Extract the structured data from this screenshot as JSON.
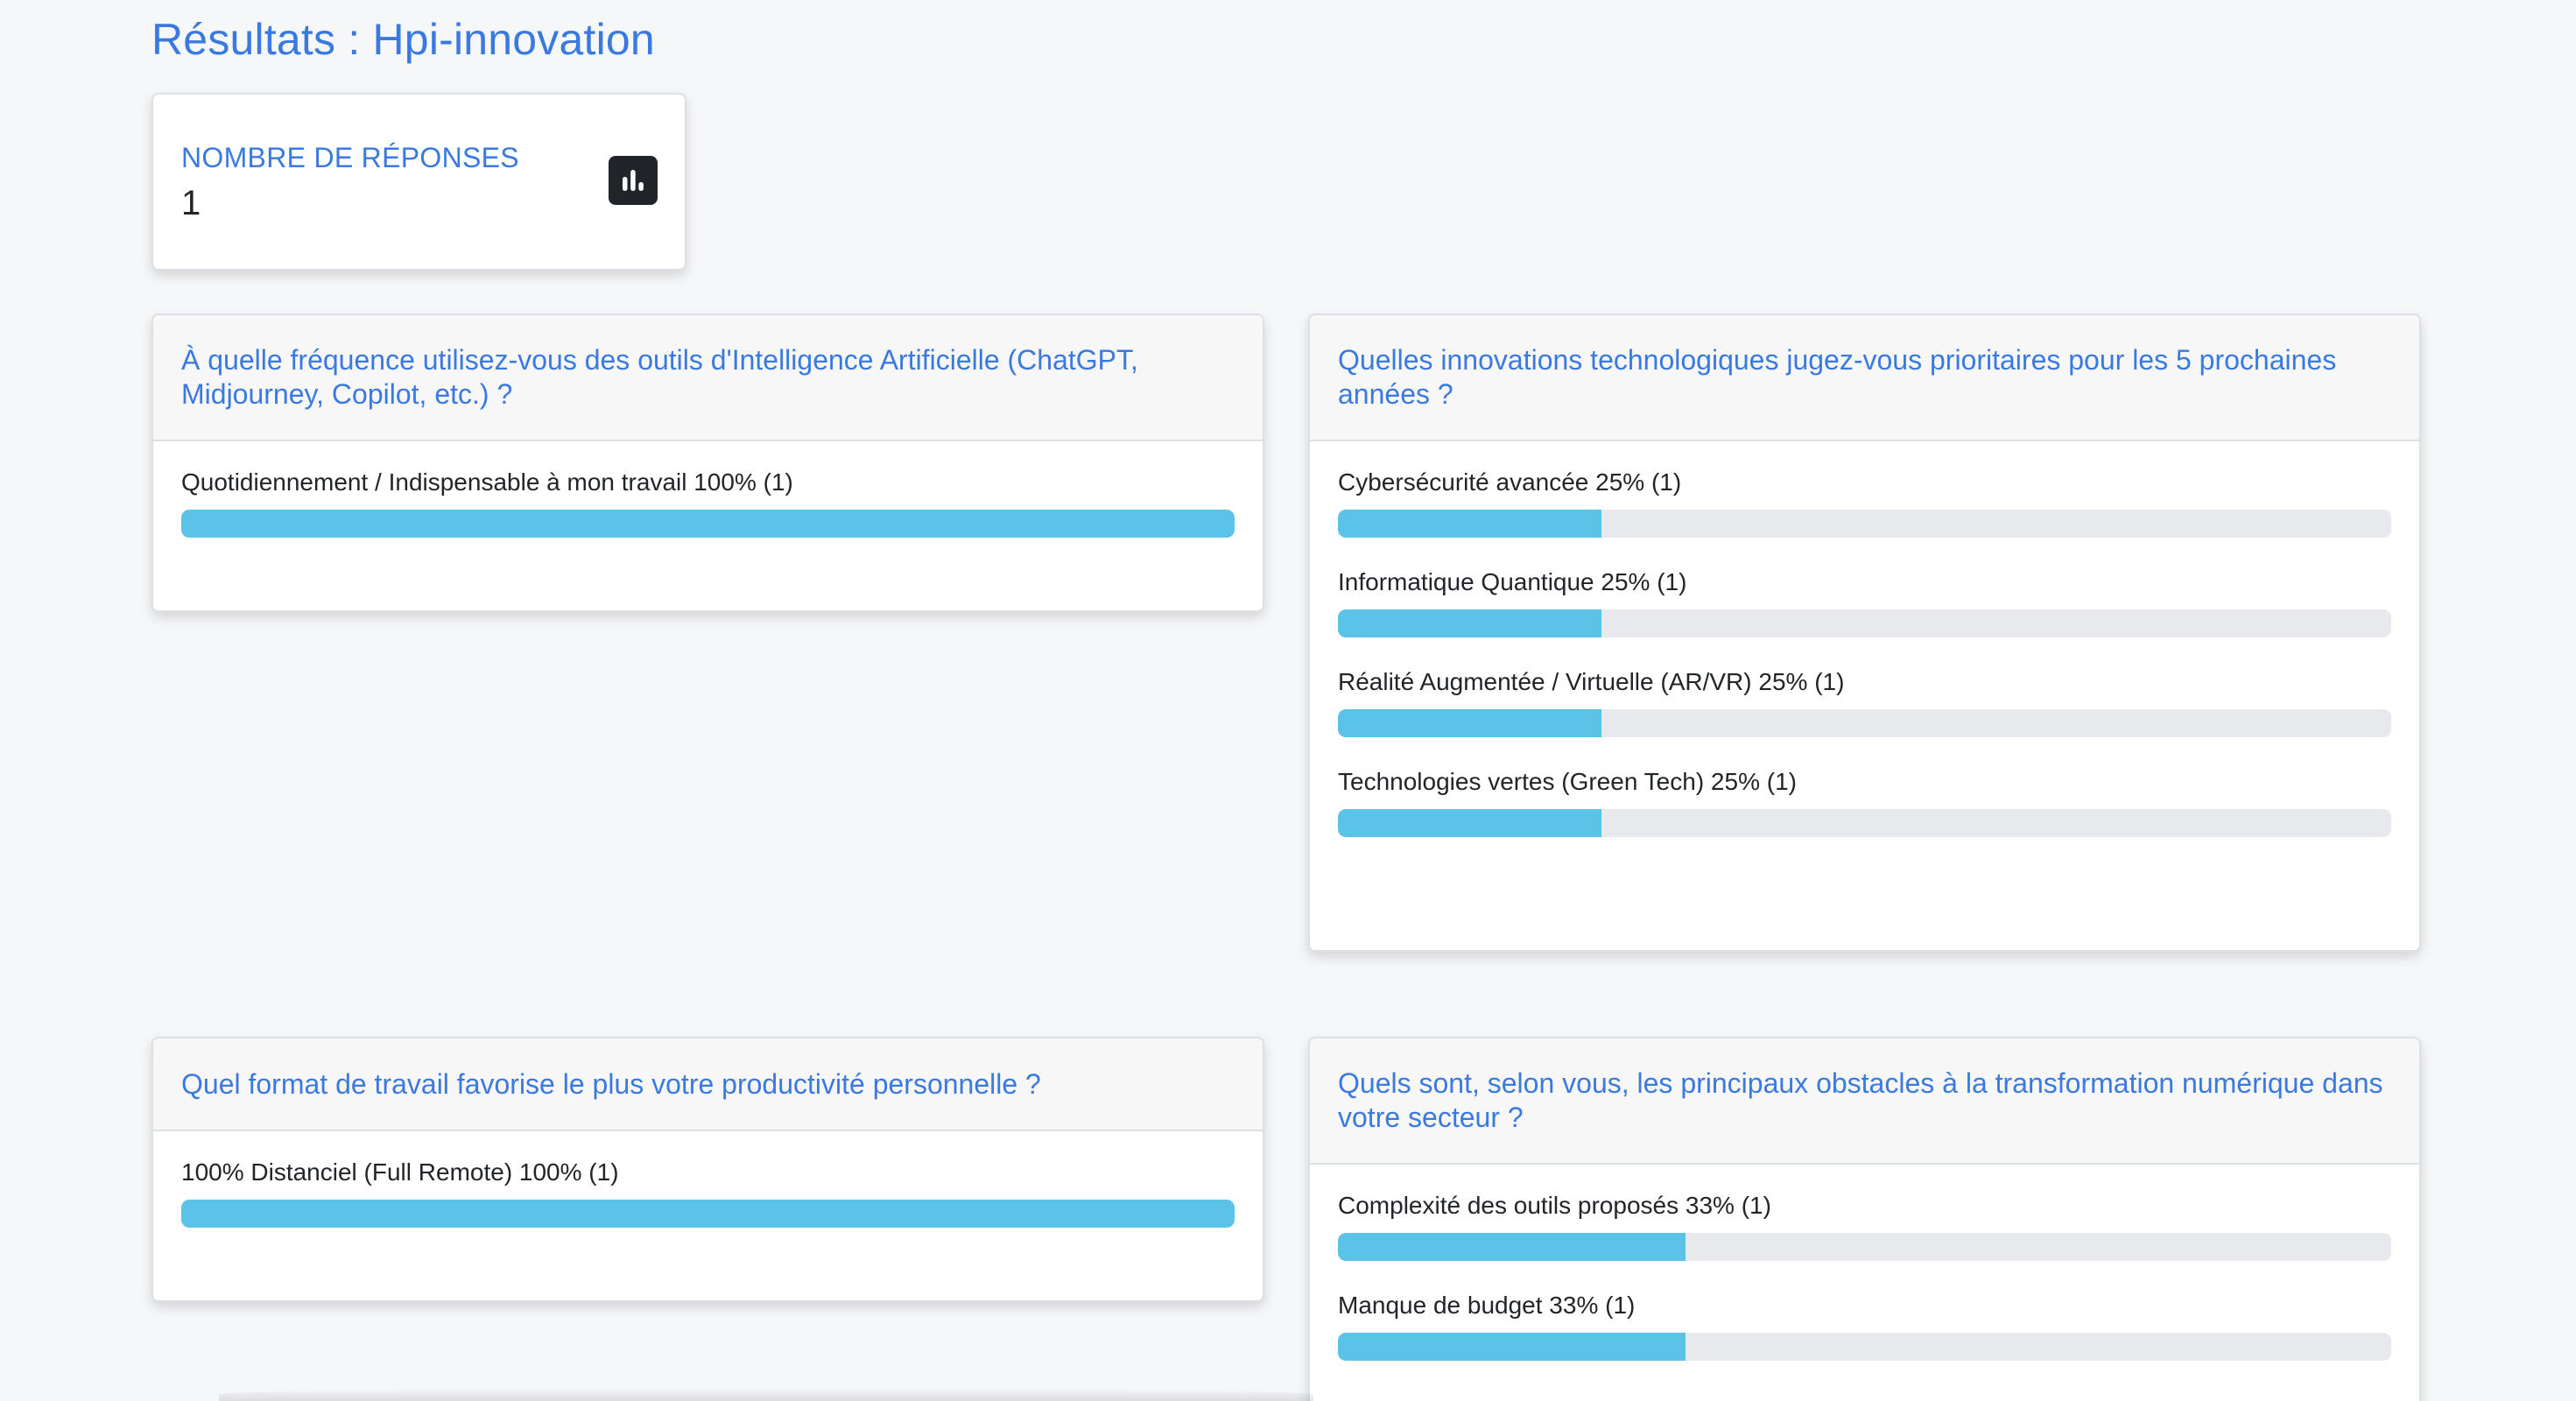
{
  "page": {
    "title": "Résultats : Hpi-innovation"
  },
  "stats": {
    "label": "NOMBRE DE RÉPONSES",
    "value": "1",
    "icon": "bar-chart-icon"
  },
  "colors": {
    "accent": "#3a7ae0",
    "bar_fill": "#5cc3e8",
    "bar_track": "#e8e9ec",
    "background": "#f6f7f9"
  },
  "questions": [
    {
      "title": "À quelle fréquence utilisez-vous des outils d'Intelligence Artificielle (ChatGPT, Midjourney, Copilot, etc.) ?",
      "options": [
        {
          "label": "Quotidiennement / Indispensable à mon travail 100% (1)",
          "percent": 100
        }
      ]
    },
    {
      "title": "Quelles innovations technologiques jugez-vous prioritaires pour les 5 prochaines années ?",
      "options": [
        {
          "label": "Cybersécurité avancée 25% (1)",
          "percent": 25
        },
        {
          "label": "Informatique Quantique 25% (1)",
          "percent": 25
        },
        {
          "label": "Réalité Augmentée / Virtuelle (AR/VR) 25% (1)",
          "percent": 25
        },
        {
          "label": "Technologies vertes (Green Tech) 25% (1)",
          "percent": 25
        }
      ]
    },
    {
      "title": "Quel format de travail favorise le plus votre productivité personnelle ?",
      "options": [
        {
          "label": "100% Distanciel (Full Remote) 100% (1)",
          "percent": 100
        }
      ]
    },
    {
      "title": "Quels sont, selon vous, les principaux obstacles à la transformation numérique dans votre secteur ?",
      "options": [
        {
          "label": "Complexité des outils proposés 33% (1)",
          "percent": 33
        },
        {
          "label": "Manque de budget 33% (1)",
          "percent": 33
        }
      ]
    }
  ]
}
